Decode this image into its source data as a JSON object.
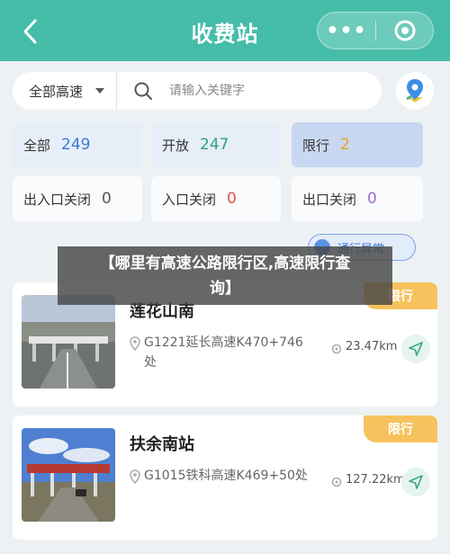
{
  "header": {
    "title": "收费站",
    "more_label": "•••"
  },
  "search": {
    "filter_value": "全部高速",
    "placeholder": "请输入关键字"
  },
  "stats": [
    {
      "label": "全部",
      "count": "249",
      "color": "#3f78d6"
    },
    {
      "label": "开放",
      "count": "247",
      "color": "#2aa57a"
    },
    {
      "label": "限行",
      "count": "2",
      "color": "#e0a11a"
    },
    {
      "label": "出入口关闭",
      "count": "0",
      "color": "#555555"
    },
    {
      "label": "入口关闭",
      "count": "0",
      "color": "#e0524a"
    },
    {
      "label": "出口关闭",
      "count": "0",
      "color": "#9a6bd6"
    }
  ],
  "tag": {
    "label": "通行异常"
  },
  "banner": {
    "line1": "【哪里有高速公路限行区,高速限行查",
    "line2": "询】"
  },
  "stations": [
    {
      "name": "莲花山南",
      "badge": "限行",
      "address": "G1221延长高速K470+746处",
      "distance": "23.47km"
    },
    {
      "name": "扶余南站",
      "badge": "限行",
      "address": "G1015铁科高速K469+50处",
      "distance": "127.22km"
    }
  ],
  "colors": {
    "header": "#45bda8",
    "badge": "#f7c25d",
    "accent_blue": "#3f78d6"
  }
}
